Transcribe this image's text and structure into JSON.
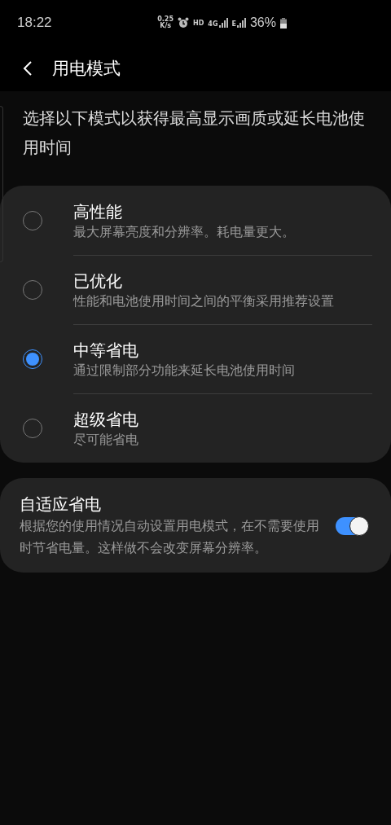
{
  "status_bar": {
    "time": "18:22",
    "net_speed": [
      "0.25",
      "K/s"
    ],
    "network_labels": [
      "HD",
      "4G",
      "E"
    ],
    "battery": "36%"
  },
  "header": {
    "title": "用电模式"
  },
  "description": "选择以下模式以获得最高显示画质或延长电池使用时间",
  "modes": [
    {
      "title": "高性能",
      "subtitle": "最大屏幕亮度和分辨率。耗电量更大。",
      "selected": false
    },
    {
      "title": "已优化",
      "subtitle": "性能和电池使用时间之间的平衡采用推荐设置",
      "selected": false
    },
    {
      "title": "中等省电",
      "subtitle": "通过限制部分功能来延长电池使用时间",
      "selected": true
    },
    {
      "title": "超级省电",
      "subtitle": "尽可能省电",
      "selected": false
    }
  ],
  "adaptive": {
    "title": "自适应省电",
    "description": "根据您的使用情况自动设置用电模式，在不需要使用时节省电量。这样做不会改变屏幕分辨率。",
    "on": true
  }
}
